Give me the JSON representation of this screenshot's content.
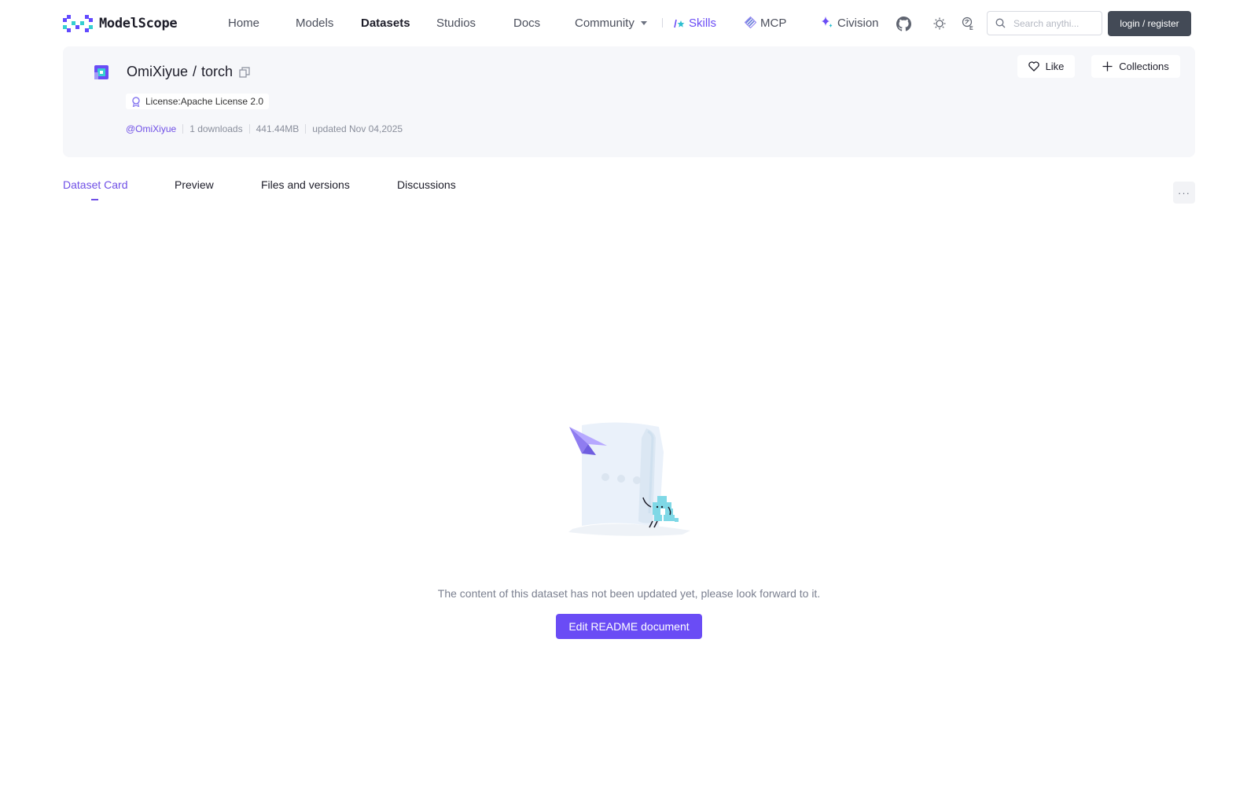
{
  "brand": {
    "logo_text": "ModelScope"
  },
  "nav": {
    "home": "Home",
    "models": "Models",
    "datasets": "Datasets",
    "studios": "Studios",
    "docs": "Docs",
    "community": "Community",
    "skills": "Skills",
    "mcp": "MCP",
    "civision": "Civision",
    "active": "Datasets"
  },
  "search": {
    "placeholder": "Search anythi..."
  },
  "auth": {
    "login_label": "login / register"
  },
  "dataset": {
    "owner": "OmiXiyue",
    "slash": "/",
    "name": "torch",
    "license": "License:Apache License 2.0",
    "owner_handle": "@OmiXiyue",
    "downloads": "1 downloads",
    "size": "441.44MB",
    "updated": "updated Nov 04,2025"
  },
  "actions": {
    "like_label": "Like",
    "collections_label": "Collections"
  },
  "tabs": [
    {
      "label": "Dataset Card",
      "active": true
    },
    {
      "label": "Preview",
      "active": false
    },
    {
      "label": "Files and versions",
      "active": false
    },
    {
      "label": "Discussions",
      "active": false
    }
  ],
  "more_label": "···",
  "empty_state": {
    "message": "The content of this dataset has not been updated yet, please look forward to it.",
    "button_label": "Edit README document"
  },
  "colors": {
    "accent": "#6f4fe6",
    "button_primary": "#6a4cf5",
    "login_bg": "#434a56",
    "card_bg": "#f6f7fa"
  }
}
